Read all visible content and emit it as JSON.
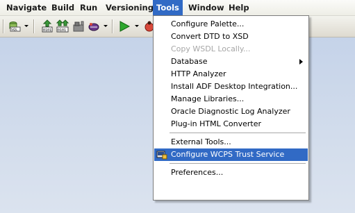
{
  "menubar": {
    "items": [
      "Navigate",
      "Build",
      "Run",
      "Versioning",
      "Tools",
      "Window",
      "Help"
    ],
    "active": "Tools"
  },
  "toolbar": {
    "buttons": [
      {
        "icon": "sql-worksheet-icon"
      },
      {
        "icon": "dropdown-arrow-icon"
      },
      {
        "icon": "make-icon"
      },
      {
        "icon": "rebuild-icon"
      },
      {
        "icon": "deploy-icon"
      },
      {
        "icon": "bug-tool-icon"
      },
      {
        "icon": "dropdown-arrow-icon"
      },
      {
        "icon": "run-icon"
      },
      {
        "icon": "dropdown-arrow-icon"
      },
      {
        "icon": "debug-icon"
      }
    ]
  },
  "tools_menu": {
    "items": [
      {
        "label": "Configure Palette...",
        "enabled": true
      },
      {
        "label": "Convert DTD to XSD",
        "enabled": true
      },
      {
        "label": "Copy WSDL Locally...",
        "enabled": false
      },
      {
        "label": "Database",
        "enabled": true,
        "submenu": true
      },
      {
        "label": "HTTP Analyzer",
        "enabled": true
      },
      {
        "label": "Install ADF Desktop Integration...",
        "enabled": true
      },
      {
        "label": "Manage Libraries...",
        "enabled": true
      },
      {
        "label": "Oracle Diagnostic Log Analyzer",
        "enabled": true
      },
      {
        "label": "Plug-in HTML Converter",
        "enabled": true
      },
      {
        "label": "External Tools...",
        "enabled": true
      },
      {
        "label": "Configure WCPS Trust Service",
        "enabled": true,
        "selected": true,
        "icon": "wcps-trust-icon"
      },
      {
        "label": "Preferences...",
        "enabled": true
      }
    ]
  },
  "colors": {
    "highlight": "#316ac5",
    "workarea": "#c9d6ea"
  }
}
